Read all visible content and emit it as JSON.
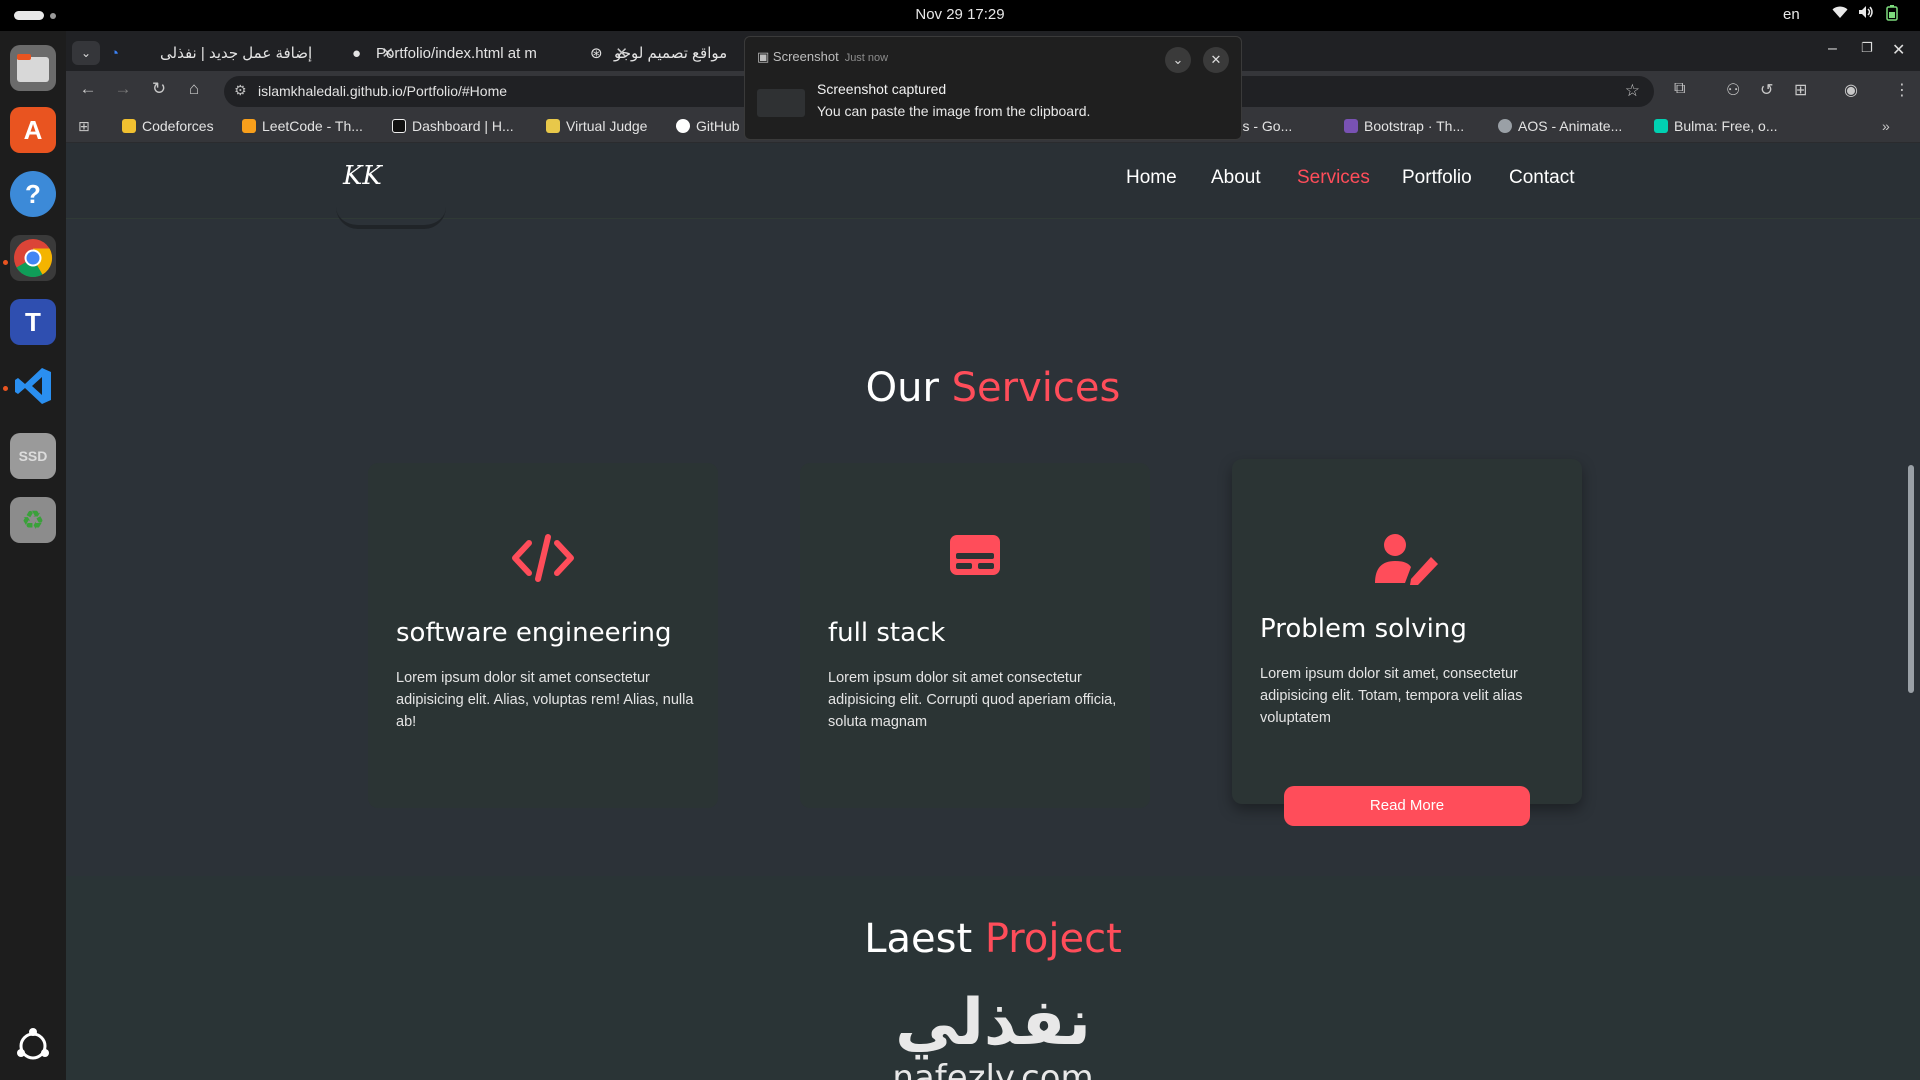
{
  "system": {
    "clock": "Nov 29  17:29",
    "language": "en"
  },
  "tabs": [
    {
      "title": "إضافة عمل جديد | نفذلى"
    },
    {
      "title": "Portfolio/index.html at m"
    },
    {
      "title": "مواقع تصميم لوجو"
    }
  ],
  "toolbar": {
    "url": "islamkhaledali.github.io/Portfolio/#Home"
  },
  "bookmarks": [
    {
      "label": "Codeforces",
      "color": "#f0c030"
    },
    {
      "label": "LeetCode - Th...",
      "color": "#f89f1b"
    },
    {
      "label": "Dashboard | H...",
      "color": "#1a1a1a"
    },
    {
      "label": "Virtual Judge",
      "color": "#e8c84a"
    },
    {
      "label": "GitHub",
      "color": "#ffffff"
    },
    {
      "label": "erials - Go...",
      "color": "#4285f4"
    },
    {
      "label": "Bootstrap · Th...",
      "color": "#7952b3"
    },
    {
      "label": "AOS - Animate...",
      "color": "#9aa0a6"
    },
    {
      "label": "Bulma: Free, o...",
      "color": "#00d1b2"
    }
  ],
  "notification": {
    "app": "Screenshot",
    "time": "Just now",
    "title": "Screenshot captured",
    "body": "You can paste the image from the clipboard."
  },
  "site": {
    "logo": "KK",
    "nav": [
      {
        "label": "Home",
        "active": false
      },
      {
        "label": "About",
        "active": false
      },
      {
        "label": "Services",
        "active": true
      },
      {
        "label": "Portfolio",
        "active": false
      },
      {
        "label": "Contact",
        "active": false
      }
    ],
    "services_heading": {
      "prefix": "Our",
      "accent": "Services"
    },
    "services": [
      {
        "icon": "code-icon",
        "title": "software engineering",
        "desc": "Lorem ipsum dolor sit amet consectetur adipisicing elit. Alias, voluptas rem! Alias, nulla ab!"
      },
      {
        "icon": "card-icon",
        "title": "full stack",
        "desc": "Lorem ipsum dolor sit amet consectetur adipisicing elit. Corrupti quod aperiam officia, soluta magnam"
      },
      {
        "icon": "user-edit-icon",
        "title": "Problem solving",
        "desc": "Lorem ipsum dolor sit amet, consectetur adipisicing elit. Totam, tempora velit alias voluptatem"
      }
    ],
    "read_more": "Read More",
    "project_heading": {
      "prefix": "Laest",
      "accent": "Project"
    },
    "project_logo_ar": "نفذلي",
    "project_logo_en": "nafezly.com"
  },
  "colors": {
    "accent": "#ff4d5a",
    "page_bg": "#2c3238",
    "card_bg": "#2b3434"
  }
}
